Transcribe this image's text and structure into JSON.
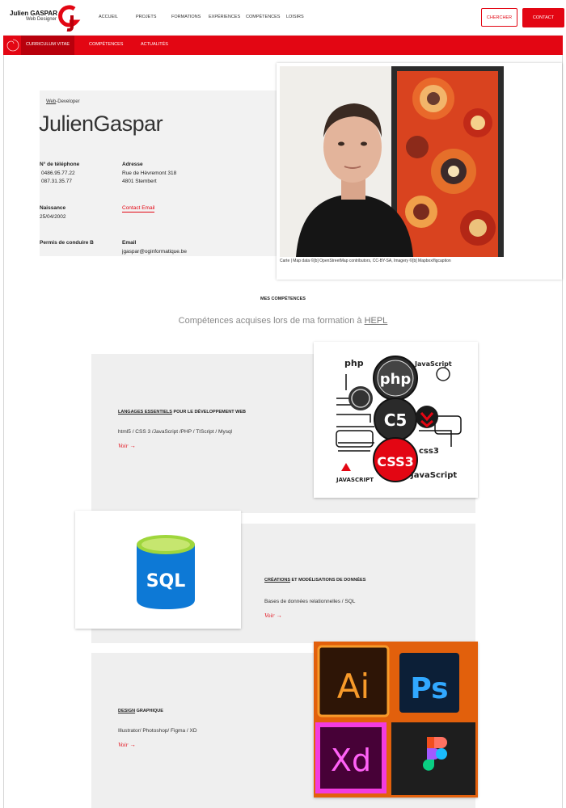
{
  "header": {
    "logo_name": "Julien GASPAR",
    "logo_sub": "Web Designer",
    "nav": [
      "ACCUEIL",
      "PROJETS",
      "FORMATIONS",
      "EXPÉRIENCES",
      "COMPÉTENCES",
      "LOISIRS"
    ],
    "search_label": "CHERCHER",
    "contact_label": "CONTACT"
  },
  "subnav": {
    "tabs": [
      "CURRICULUM VITAE",
      "COMPÉTENCES",
      "ACTUALITÉS"
    ]
  },
  "profile": {
    "role_prefix": "Web",
    "role_rest": "-Developer",
    "first_name": "Julien",
    "last_name": "Gaspar",
    "phone_label": "N° de téléphone",
    "phone_1": "0486.95.77.22",
    "phone_2": "087.31.35.77",
    "address_label": "Adresse",
    "address_1": "Rue de Hèvremont 318",
    "address_2": "4801 Stembert",
    "birth_label": "Naissance",
    "birth_value": "25/04/2002",
    "contact_link": "Contact Email",
    "license_label": "Permis de conduire B",
    "email_label": "Email",
    "email_value": "jgaspar@oginformatique.be",
    "photo_caption": "Carte | Map data ©[b] OpenStreetMap contributors, CC-BY-SA, Imagery ©[b] Mapbox/figcaption"
  },
  "skills_section": {
    "title": "MES COMPÉTENCES",
    "subtitle_prefix": "Compétences acquises lors de ma formation à ",
    "subtitle_link": "HEPL"
  },
  "skills": [
    {
      "title_u": "LANGAGES ESSENTIELS",
      "title_rest": " POUR LE DÉVELOPPEMENT WEB",
      "desc": "html5 / CSS 3 /JavaScript /PHP / TIScript / Mysql",
      "link": "Voir →",
      "image_labels": [
        "php",
        "php",
        "JavaScript",
        "C5",
        "CSS3",
        "css3",
        "JAVASCRIPT",
        "JavaScript"
      ]
    },
    {
      "title_u": "CRÉATIONS",
      "title_rest": " ET MODÉLISATIONS DE DONNÉES",
      "desc": "Bases de données relationnelles / SQL",
      "link": "Voir →",
      "image_labels": [
        "SQL"
      ]
    },
    {
      "title_u": "DESIGN",
      "title_rest": " GRAPHIQUE",
      "desc": "Illustrator/ Photoshop/ Figma / XD",
      "link": "Voir →",
      "image_labels": [
        "Ai",
        "Ps",
        "Xd"
      ]
    }
  ],
  "colors": {
    "brand_red": "#e30613",
    "panel_grey": "#efefef"
  }
}
